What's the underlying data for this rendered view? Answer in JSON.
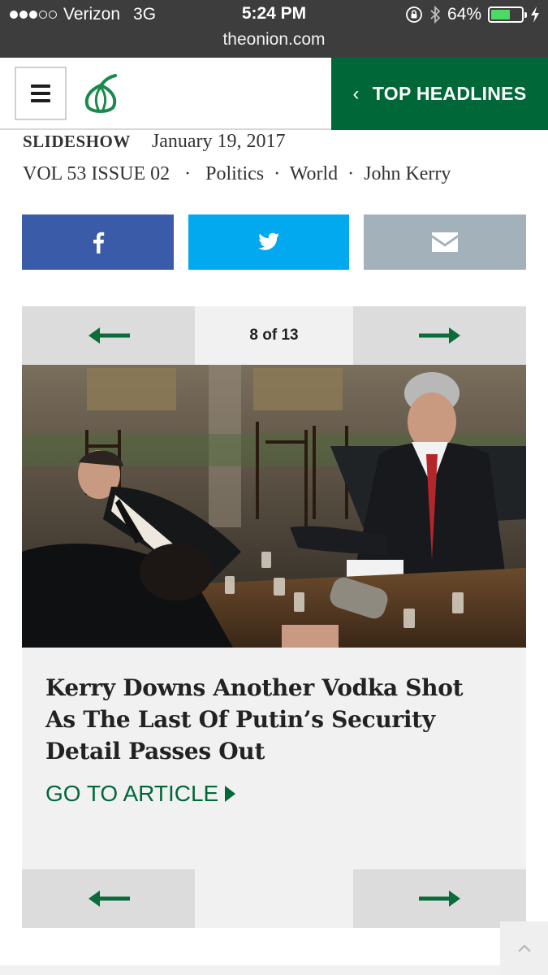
{
  "status_bar": {
    "carrier": "Verizon",
    "network": "3G",
    "time": "5:24 PM",
    "url": "theonion.com",
    "battery": "64%",
    "battery_level": 0.64,
    "signal_bars_filled": 3,
    "signal_bars_total": 5
  },
  "header": {
    "top_headlines_label": "TOP HEADLINES",
    "logo_icon": "onion-logo-icon",
    "brand_color": "#006838"
  },
  "meta": {
    "type_label": "SLIDESHOW",
    "date": "January 19, 2017",
    "issue": "VOL 53 ISSUE 02",
    "tags": [
      "Politics",
      "World",
      "John Kerry"
    ]
  },
  "share": {
    "facebook_color": "#3a5ba7",
    "twitter_color": "#03a9ef",
    "email_color": "#a3b1bb"
  },
  "slideshow": {
    "counter": "8 of 13",
    "headline": "Kerry Downs Another Vodka Shot As The Last Of Putin’s Security Detail Passes Out",
    "cta": "GO TO ARTICLE"
  }
}
